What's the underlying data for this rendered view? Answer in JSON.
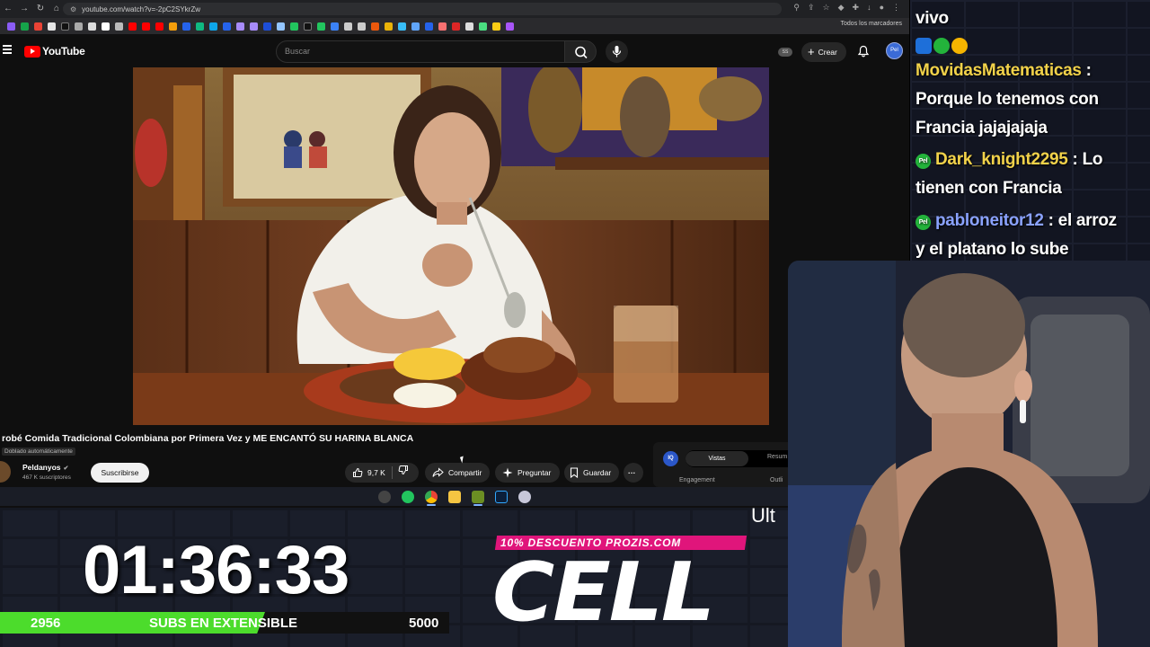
{
  "browser": {
    "url": "youtube.com/watch?v=-2pC2SYkrZw",
    "bookmarks_folder_label": "Todos los marcadores"
  },
  "youtube": {
    "logo_text": "YouTube",
    "search_placeholder": "Buscar",
    "header_badge": "SS",
    "create_label": "Crear",
    "avatar_text": "Pel"
  },
  "video": {
    "title": "robé Comida Tradicional Colombiana por Primera Vez y ME ENCANTÓ SU HARINA BLANCA",
    "dub_badge": "Doblado automáticamente",
    "channel_name": "Peldanyos",
    "channel_subs": "467 K suscriptores",
    "subscribe_label": "Suscribirse",
    "like_count": "9,7 K",
    "share_label": "Compartir",
    "ask_label": "Preguntar",
    "save_label": "Guardar",
    "more_label": "···"
  },
  "side_panel": {
    "logo_text": "IQ",
    "tab_active": "Vistas",
    "tab_next": "Resum",
    "label_left": "Engagement",
    "label_right": "Outli"
  },
  "chat": {
    "messages": [
      {
        "name": "",
        "text": "vivo"
      },
      {
        "name": "MovidasMatematicas",
        "text": " :"
      },
      {
        "name": "",
        "text": "Porque lo tenemos con"
      },
      {
        "name": "",
        "text": "Francia jajajajaja"
      },
      {
        "name": "Dark_knight2295",
        "text": " : Lo"
      },
      {
        "name": "",
        "text": "tienen con Francia"
      },
      {
        "name": "pabloneitor12",
        "text": " : el arroz"
      },
      {
        "name": "",
        "text": "y el platano lo sube"
      }
    ],
    "badge_text": "Pel",
    "name_color": "#f2d24a",
    "name_color_alt": "#8aa2ff"
  },
  "overlay": {
    "timer": "01:36:33",
    "subs_current": "2956",
    "subs_label": "SUBS EN EXTENSIBLE",
    "subs_goal": "5000",
    "subs_progress": 0.59,
    "promo_text": "10% DESCUENTO PROZIS.COM",
    "sponsor": "CELL",
    "partial_text": "Ult"
  },
  "colors": {
    "youtube_red": "#ff0000",
    "subs_green": "#4cdc2c",
    "promo_pink": "#e0157b",
    "chat_name_gold": "#f2d24a"
  }
}
